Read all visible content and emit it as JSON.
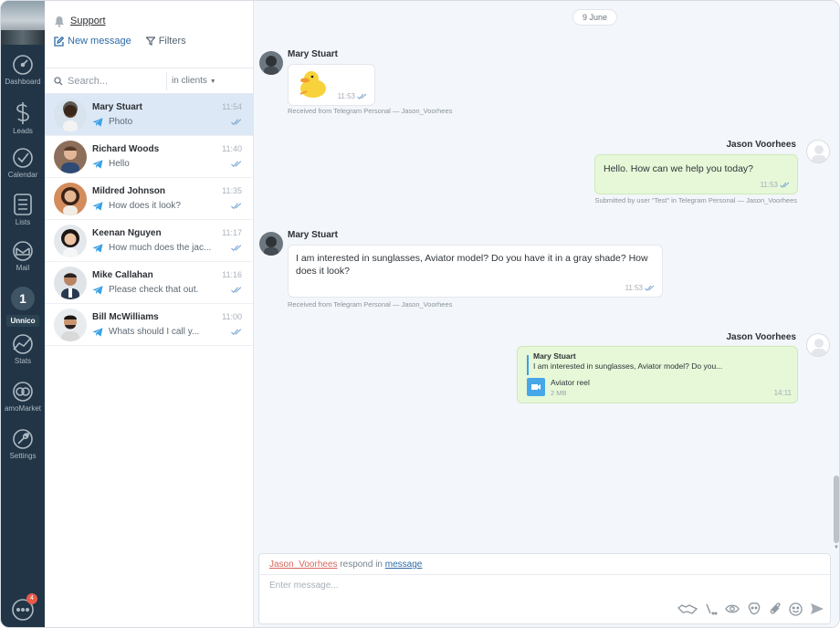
{
  "nav": {
    "items": [
      {
        "label": "Dashboard",
        "icon": "dashboard-icon"
      },
      {
        "label": "Leads",
        "icon": "leads-dollar-icon"
      },
      {
        "label": "Calendar",
        "icon": "calendar-check-icon"
      },
      {
        "label": "Lists",
        "icon": "lists-icon"
      },
      {
        "label": "Mail",
        "icon": "mail-icon"
      },
      {
        "label": "Stats",
        "icon": "stats-icon"
      },
      {
        "label": "amoMarket",
        "icon": "amomarket-icon"
      },
      {
        "label": "Settings",
        "icon": "settings-icon"
      }
    ],
    "unnico": {
      "number": "1",
      "label": "Unnico"
    },
    "chat_badge": "4"
  },
  "list": {
    "title": "Support",
    "new_message": "New message",
    "filters": "Filters",
    "search_placeholder": "Search...",
    "scope": "in clients",
    "chats": [
      {
        "name": "Mary Stuart",
        "time": "11:54",
        "preview": "Photo",
        "active": true
      },
      {
        "name": "Richard Woods",
        "time": "11:40",
        "preview": "Hello",
        "active": false
      },
      {
        "name": "Mildred Johnson",
        "time": "11:35",
        "preview": "How does it look?",
        "active": false
      },
      {
        "name": "Keenan Nguyen",
        "time": "11:17",
        "preview": "How much does the jac...",
        "active": false
      },
      {
        "name": "Mike Callahan",
        "time": "11:16",
        "preview": "Please check that out.",
        "active": false
      },
      {
        "name": "Bill McWilliams",
        "time": "11:00",
        "preview": "Whats should I call y...",
        "active": false
      }
    ]
  },
  "conversation": {
    "date": "9 June",
    "messages": [
      {
        "sender": "Mary Stuart",
        "time": "11:53",
        "meta": "Received from Telegram Personal — Jason_Voorhees"
      },
      {
        "sender": "Jason Voorhees",
        "text": "Hello. How can we help you today?",
        "time": "11:53",
        "meta": "Submitted by user \"Test\" in Telegram Personal — Jason_Voorhees"
      },
      {
        "sender": "Mary Stuart",
        "text": "I am interested in sunglasses, Aviator model? Do you have it in a gray shade? How does it look?",
        "time": "11:53",
        "meta": "Received from Telegram Personal — Jason_Voorhees"
      },
      {
        "sender": "Jason Voorhees",
        "reply_name": "Mary Stuart",
        "reply_text": "I am interested in sunglasses, Aviator model? Do you...",
        "file_name": "Aviator reel",
        "file_size": "2 MB",
        "time": "14:11"
      }
    ]
  },
  "composer": {
    "respond_user": "Jason_Voorhees",
    "respond_mid": "respond in",
    "respond_link": "message",
    "placeholder": "Enter message..."
  },
  "colors": {
    "nav_bg": "#213546",
    "active_chat": "#dde8f6",
    "outgoing_bubble": "#e6f8d8",
    "link": "#2e6ba6",
    "telegram": "#3aa0e6"
  }
}
